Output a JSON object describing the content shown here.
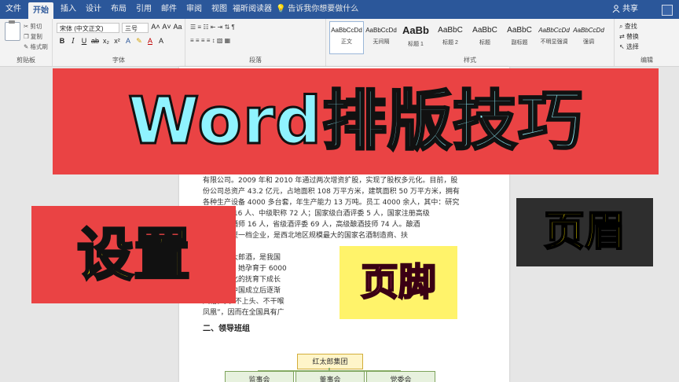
{
  "tabs": [
    "文件",
    "开始",
    "插入",
    "设计",
    "布局",
    "引用",
    "邮件",
    "审阅",
    "视图",
    "福昕阅读器"
  ],
  "tell_me": "告诉我你想要做什么",
  "share": "共享",
  "ribbon": {
    "clipboard": {
      "label": "剪贴板",
      "cut": "剪切",
      "copy": "复制",
      "format_painter": "格式刷"
    },
    "font": {
      "label": "字体",
      "font_name": "宋体 (中文正文)",
      "font_size": "三号"
    },
    "paragraph": {
      "label": "段落"
    },
    "styles": {
      "label": "样式",
      "items": [
        {
          "sample": "AaBbCcDd",
          "name": "正文"
        },
        {
          "sample": "AaBbCcDd",
          "name": "无间隔"
        },
        {
          "sample": "AaBb",
          "name": "标题 1"
        },
        {
          "sample": "AaBbC",
          "name": "标题 2"
        },
        {
          "sample": "AaBbC",
          "name": "标题"
        },
        {
          "sample": "AaBbC",
          "name": "副标题"
        },
        {
          "sample": "AaBbCcDd",
          "name": "不明显强调"
        },
        {
          "sample": "AaBbCcDd",
          "name": "强调"
        }
      ]
    },
    "editing": {
      "label": "编辑",
      "find": "查找",
      "replace": "替换",
      "select": "选择"
    }
  },
  "document": {
    "lines": [
      "有限公司。2009 年和 2010 年通过两次增资扩股，实现了股权多元化。目前，股",
      "份公司总资产 43.2 亿元，占地面积 108 万平方米，建筑面积 50 万平方米，拥有",
      "各种生产设备 4000 多台套，年生产能力 13 万吨。员工 4000 余人，其中：研究",
      "高级职称 16 人、中级职称 72 人；国家级白酒评委 5 人，国家注册高级",
      "、十级品酒师 16 人，省级酒评委 69 人，高级酿酒技师 74 人。酿酒",
      "属国家大型一档企业，是西北地区规模最大的国家名酒制造商、扶",
      "户之一。",
      "导产品红太郎酒，是我国",
      "典型代表，她孕育于 6000",
      "在秦豪文化的抚育下成长",
      "海外，新中国成立后逐渐",
      "风格，其“不上头、不干喉",
      "凤凰”，因而在全国具有广"
    ],
    "heading": "二、领导班组",
    "org": {
      "root": "红太郎集团",
      "children": [
        "监事会",
        "董事会",
        "党委会"
      ]
    }
  },
  "overlay": {
    "title": "Word排版技巧",
    "sticker_set": "设置",
    "sticker_footer": "页脚",
    "sticker_header": "页眉"
  }
}
